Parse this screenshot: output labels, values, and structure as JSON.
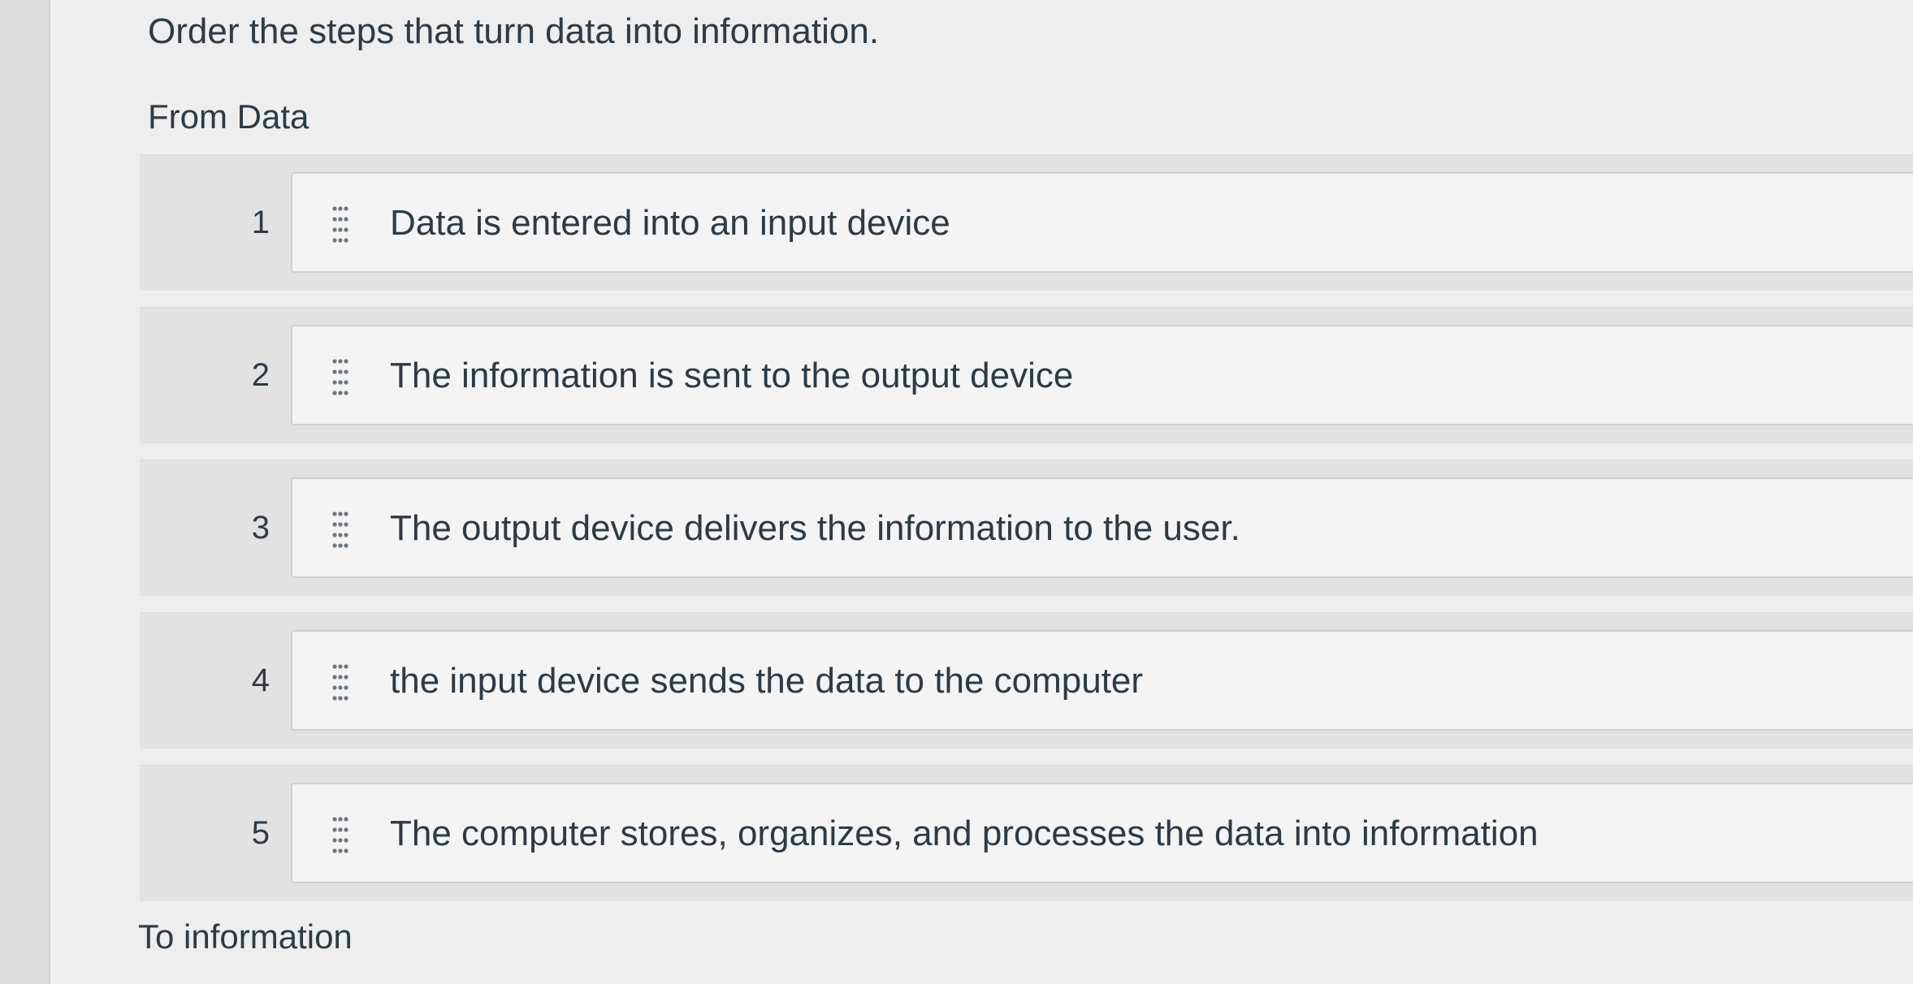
{
  "question": {
    "prompt": "Order the steps that turn data into information."
  },
  "ordering": {
    "top_label": "From Data",
    "bottom_label": "To information",
    "steps": [
      {
        "number": "1",
        "text": "Data is entered into an input device"
      },
      {
        "number": "2",
        "text": "The information is sent to the output device"
      },
      {
        "number": "3",
        "text": "The output device delivers the information to the user."
      },
      {
        "number": "4",
        "text": "the input device sends the data to the computer"
      },
      {
        "number": "5",
        "text": "The computer stores, organizes, and processes the data into information"
      }
    ],
    "handle_icon": "drag-handle-icon"
  }
}
